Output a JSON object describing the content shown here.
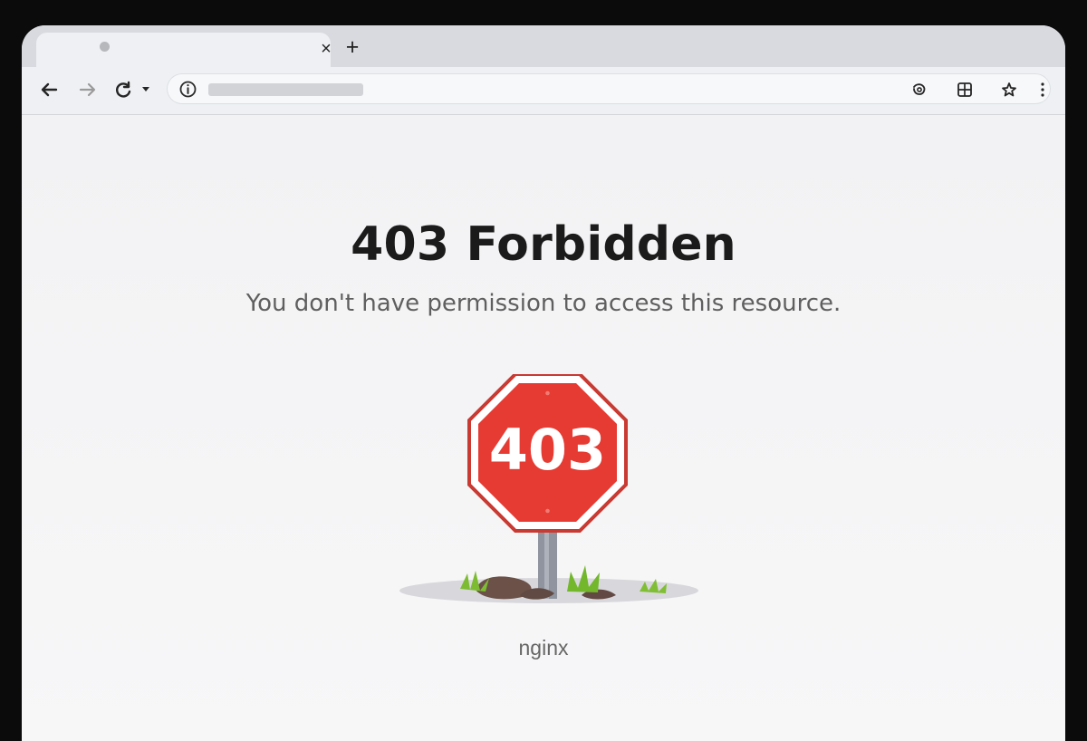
{
  "browser": {
    "tab_close": "×",
    "new_tab": "+",
    "toolbar": {
      "back_icon": "back-arrow-icon",
      "forward_icon": "forward-arrow-icon",
      "reload_icon": "reload-icon",
      "site_info_icon": "info-icon",
      "lens_icon": "lens-icon",
      "extensions_icon": "grid-icon",
      "bookmark_icon": "bookmark-star-icon",
      "menu_icon": "more-vertical-icon"
    }
  },
  "page": {
    "title": "403 Forbidden",
    "message": "You don't have permission to access this resource.",
    "sign_code": "403",
    "server": "nginx"
  },
  "colors": {
    "sign_red": "#e63b33",
    "sign_border": "#ffffff",
    "text_dark": "#1b1b1b",
    "text_muted": "#5f5f5f"
  }
}
